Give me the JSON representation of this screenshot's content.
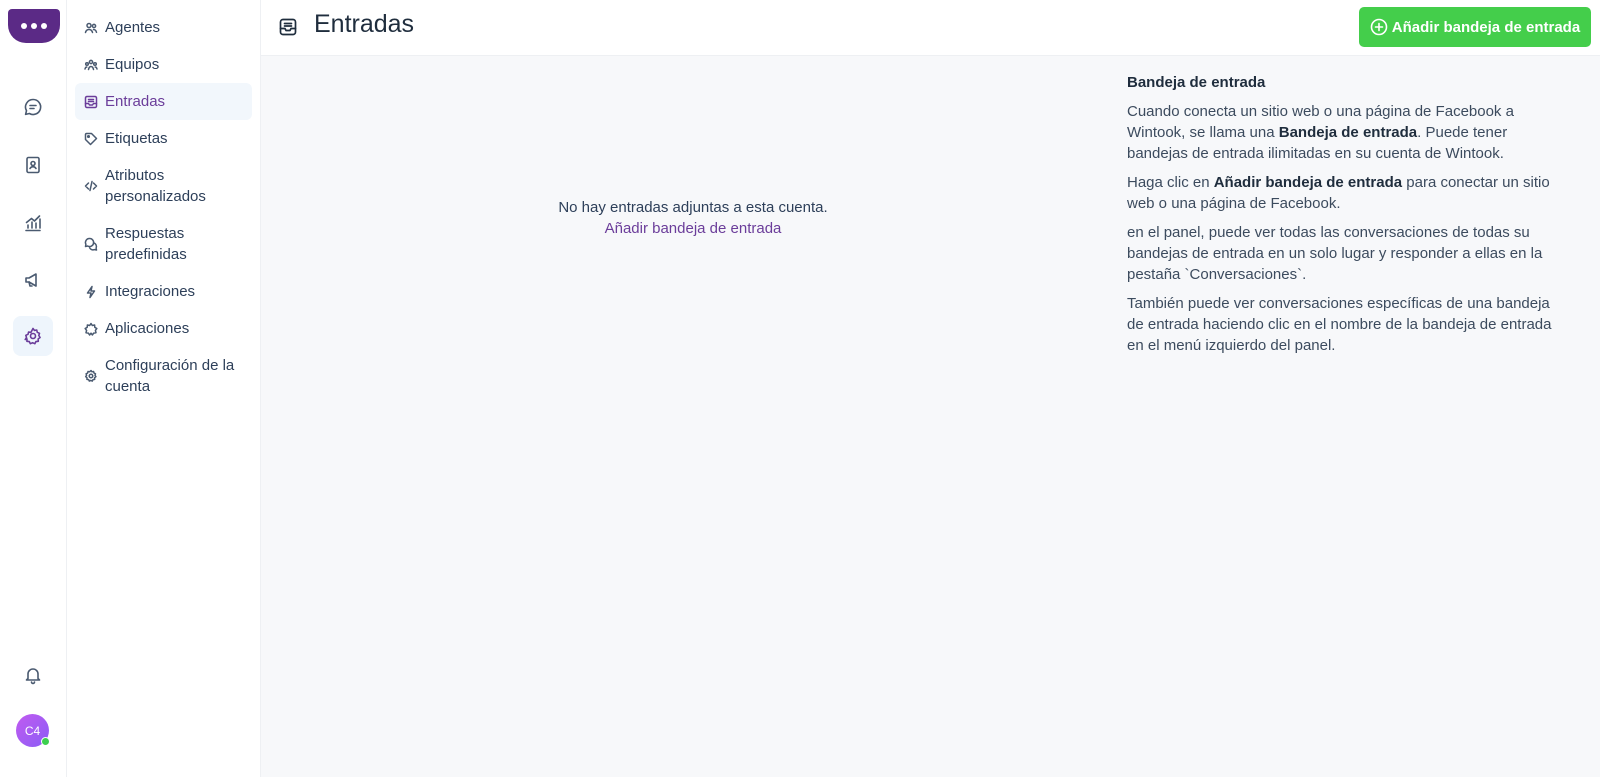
{
  "rail": {
    "logo_icon": "chat-bubble-dots-icon",
    "items": [
      {
        "icon": "conversations-icon"
      },
      {
        "icon": "contacts-icon"
      },
      {
        "icon": "reports-icon"
      },
      {
        "icon": "campaigns-icon"
      },
      {
        "icon": "settings-icon",
        "active": true
      }
    ],
    "notifications_icon": "bell-icon",
    "avatar_initials": "C4",
    "status_color": "#3ccf4e"
  },
  "sidebar": {
    "items": [
      {
        "label": "Agentes",
        "icon": "users-icon"
      },
      {
        "label": "Equipos",
        "icon": "team-icon"
      },
      {
        "label": "Entradas",
        "icon": "inbox-icon",
        "active": true
      },
      {
        "label": "Etiquetas",
        "icon": "tag-icon"
      },
      {
        "label": "Atributos personalizados",
        "icon": "code-icon"
      },
      {
        "label": "Respuestas predefinidas",
        "icon": "chat-multiple-icon"
      },
      {
        "label": "Integraciones",
        "icon": "flash-icon"
      },
      {
        "label": "Aplicaciones",
        "icon": "star-badge-icon"
      },
      {
        "label": "Configuración de la cuenta",
        "icon": "gear-icon"
      }
    ]
  },
  "header": {
    "title": "Entradas",
    "icon": "inbox-icon",
    "add_button": "Añadir bandeja de entrada"
  },
  "empty_state": {
    "message": "No hay entradas adjuntas a esta cuenta.",
    "link": "Añadir bandeja de entrada"
  },
  "help": {
    "title": "Bandeja de entrada",
    "p1_a": "Cuando conecta un sitio web o una página de Facebook a Wintook, se llama una ",
    "p1_b": "Bandeja de entrada",
    "p1_c": ". Puede tener bandejas de entrada ilimitadas en su cuenta de Wintook.",
    "p2_a": "Haga clic en ",
    "p2_b": "Añadir bandeja de entrada",
    "p2_c": " para conectar un sitio web o una página de Facebook.",
    "p3": "en el panel, puede ver todas las conversaciones de todas su bandejas de entrada en un solo lugar y responder a ellas en la pestaña `Conversaciones`.",
    "p4": "También puede ver conversaciones específicas de una bandeja de entrada haciendo clic en el nombre de la bandeja de entrada en el menú izquierdo del panel."
  },
  "colors": {
    "brand": "#5b2a86",
    "accent": "#6b3d9a",
    "primary_button": "#44ce4b"
  }
}
